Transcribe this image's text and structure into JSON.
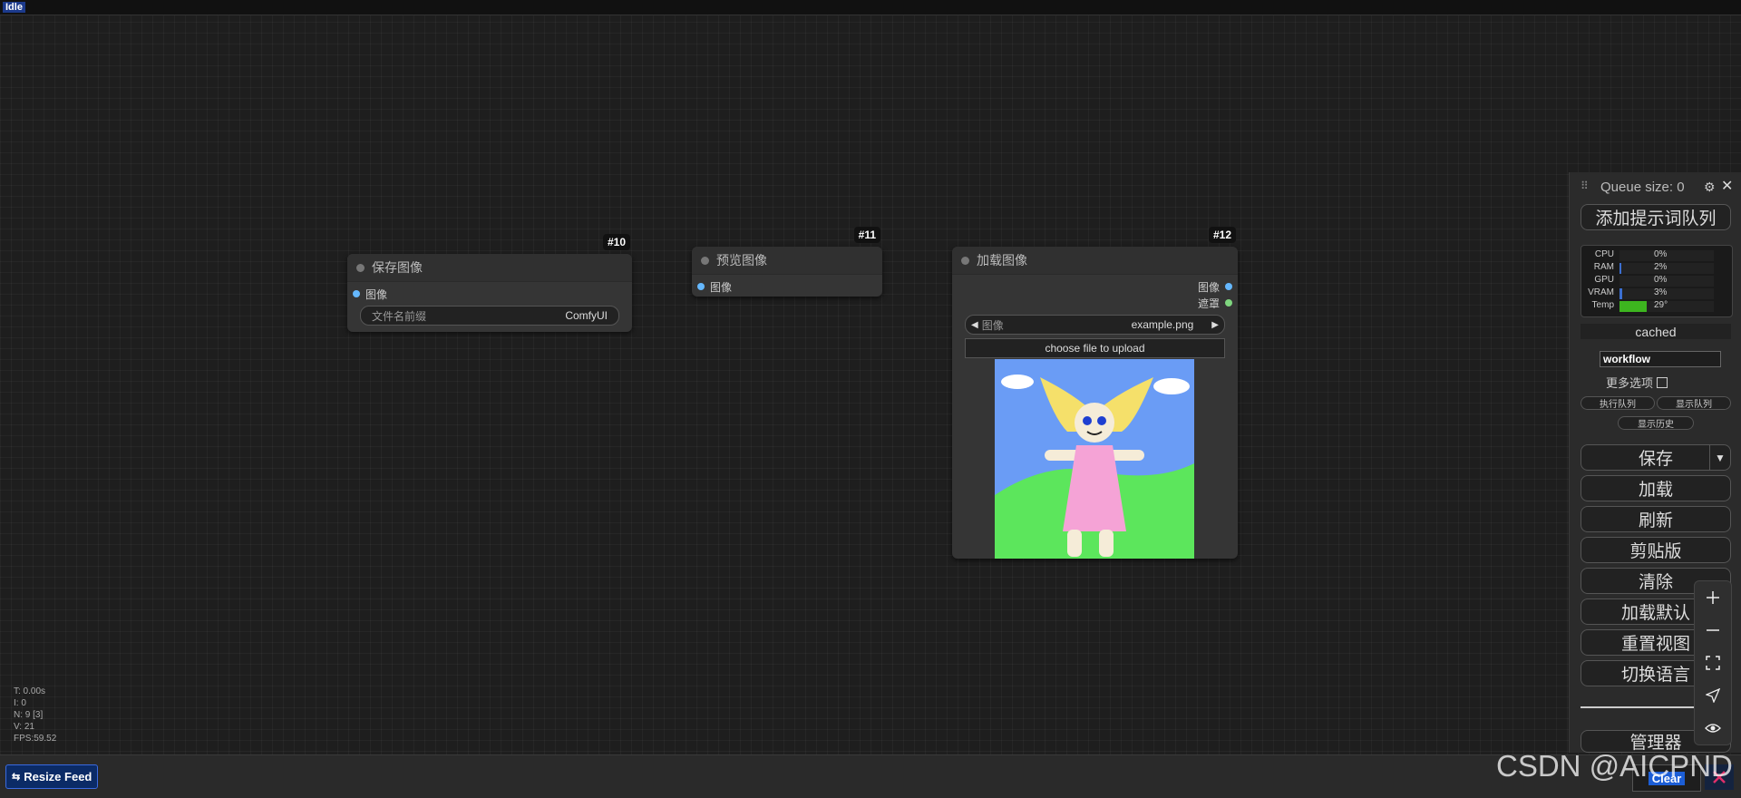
{
  "status": {
    "idle": "Idle"
  },
  "nodes": {
    "save": {
      "id": "#10",
      "title": "保存图像",
      "input": "图像",
      "widget_label": "文件名前缀",
      "widget_value": "ComfyUI"
    },
    "preview": {
      "id": "#11",
      "title": "预览图像",
      "input": "图像"
    },
    "load": {
      "id": "#12",
      "title": "加载图像",
      "out_image": "图像",
      "out_mask": "遮罩",
      "combo_label": "图像",
      "combo_value": "example.png",
      "upload_label": "choose file to upload"
    }
  },
  "panel": {
    "queue_size": "Queue size: 0",
    "queue_prompt": "添加提示词队列",
    "monitor": [
      {
        "label": "CPU",
        "value": "0%",
        "fill": 0,
        "color": "#3b6fd1"
      },
      {
        "label": "RAM",
        "value": "2%",
        "fill": 0.02,
        "color": "#3b6fd1"
      },
      {
        "label": "GPU",
        "value": "0%",
        "fill": 0,
        "color": "#3b6fd1"
      },
      {
        "label": "VRAM",
        "value": "3%",
        "fill": 0.03,
        "color": "#3b6fd1"
      },
      {
        "label": "Temp",
        "value": "29°",
        "fill": 0.29,
        "color": "#3db51f"
      }
    ],
    "cached": "cached",
    "workflow_value": "workflow",
    "more_options": "更多选项",
    "run_queue": "执行队列",
    "show_queue": "显示队列",
    "show_history": "显示历史",
    "save": "保存",
    "load": "加载",
    "refresh": "刷新",
    "clipspace": "剪贴版",
    "clear": "清除",
    "load_default": "加载默认",
    "reset_view": "重置视图",
    "switch_lang": "切换语言",
    "manager": "管理器"
  },
  "stats": {
    "t": "T: 0.00s",
    "i": "I: 0",
    "n": "N: 9 [3]",
    "v": "V: 21",
    "fps": "FPS:59.52"
  },
  "bottom": {
    "resize_feed": "Resize Feed",
    "clear": "Clear"
  },
  "watermark": "CSDN @AICPND"
}
